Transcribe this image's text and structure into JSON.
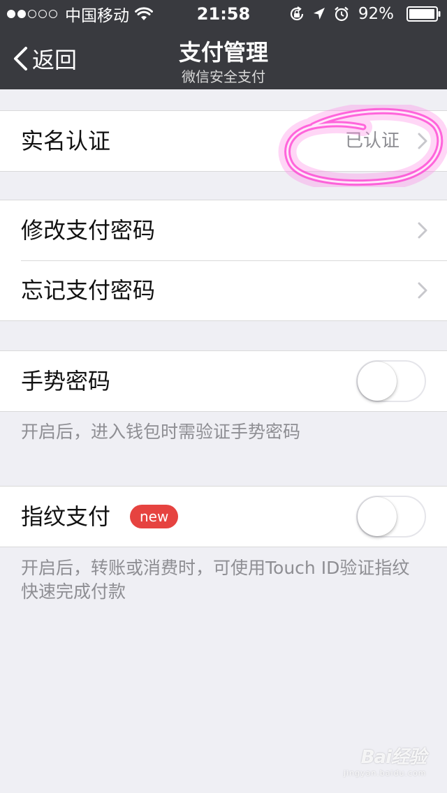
{
  "status_bar": {
    "carrier": "中国移动",
    "time": "21:58",
    "battery": "92%"
  },
  "nav": {
    "back_label": "返回",
    "title": "支付管理",
    "subtitle": "微信安全支付"
  },
  "groups": {
    "verification": {
      "label": "实名认证",
      "value": "已认证"
    },
    "password": {
      "change": "修改支付密码",
      "forgot": "忘记支付密码"
    },
    "gesture": {
      "label": "手势密码",
      "enabled": false,
      "hint": "开启后，进入钱包时需验证手势密码"
    },
    "fingerprint": {
      "label": "指纹支付",
      "badge": "new",
      "enabled": false,
      "hint": "开启后，转账或消费时，可使用Touch ID验证指纹快速完成付款"
    }
  },
  "watermark": {
    "logo": "Bai经验",
    "url": "jingyan.baidu.com"
  },
  "colors": {
    "nav_background": "#393a3f",
    "page_background": "#efeff4",
    "badge": "#e64340",
    "highlight": "#ff3fd2"
  }
}
